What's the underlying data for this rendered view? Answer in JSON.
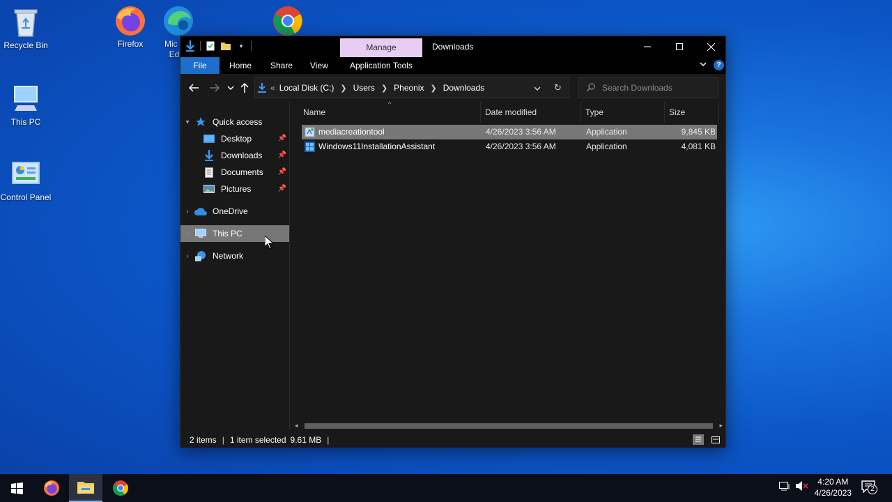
{
  "desktop": {
    "icons": [
      {
        "label": "Recycle Bin"
      },
      {
        "label": "Firefox"
      },
      {
        "label": "Mic\nEd"
      },
      {
        "label": "This PC"
      },
      {
        "label": "Control Panel"
      }
    ]
  },
  "window": {
    "manage_tab": "Manage",
    "title": "Downloads",
    "ribbon_tabs": [
      "File",
      "Home",
      "Share",
      "View",
      "Application Tools"
    ],
    "breadcrumb": [
      "Local Disk (C:)",
      "Users",
      "Pheonix",
      "Downloads"
    ],
    "breadcrumb_prefix": "«",
    "search_placeholder": "Search Downloads",
    "nav": {
      "quick_access": "Quick access",
      "items": [
        {
          "label": "Desktop"
        },
        {
          "label": "Downloads"
        },
        {
          "label": "Documents"
        },
        {
          "label": "Pictures"
        }
      ],
      "onedrive": "OneDrive",
      "this_pc": "This PC",
      "network": "Network"
    },
    "columns": [
      "Name",
      "Date modified",
      "Type",
      "Size"
    ],
    "files": [
      {
        "name": "mediacreationtool",
        "date": "4/26/2023 3:56 AM",
        "type": "Application",
        "size": "9,845 KB"
      },
      {
        "name": "Windows11InstallationAssistant",
        "date": "4/26/2023 3:56 AM",
        "type": "Application",
        "size": "4,081 KB"
      }
    ],
    "status": {
      "items": "2 items",
      "selected": "1 item selected",
      "selected_size": "9.61 MB"
    }
  },
  "taskbar": {
    "time": "4:20 AM",
    "date": "4/26/2023",
    "notification_count": "2"
  },
  "colors": {
    "accent": "#1d6fca",
    "manage_tab": "#e7cdf3",
    "selection": "#777777"
  }
}
